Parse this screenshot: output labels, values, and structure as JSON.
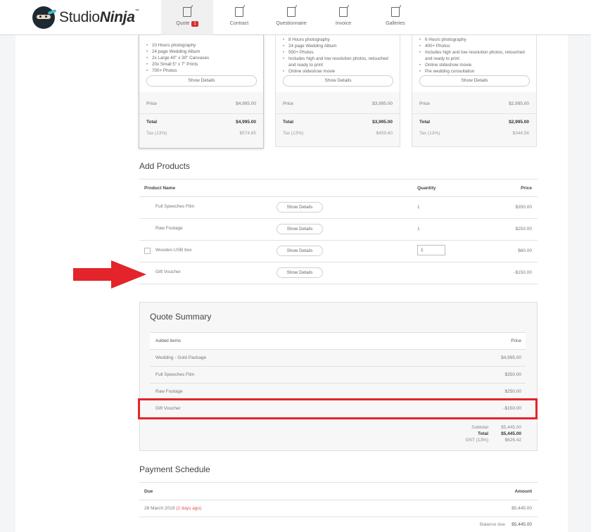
{
  "brand": {
    "name_light": "Studio",
    "name_bold": "Ninja",
    "tm": "™"
  },
  "nav": [
    {
      "label": "Quote",
      "badge": "1"
    },
    {
      "label": "Contract"
    },
    {
      "label": "Questionnaire"
    },
    {
      "label": "Invoice"
    },
    {
      "label": "Galleries"
    }
  ],
  "packages": [
    {
      "features": [
        "10 Hours photography",
        "24 page Wedding Album",
        "2x Large 40\" x 30\" Canvases",
        "20x Small 5\" x 7\" Prints",
        "700+ Photos"
      ],
      "show_details": "Show Details",
      "price_label": "Price",
      "price": "$4,995.00",
      "total_label": "Total",
      "total": "$4,995.00",
      "tax_label": "Tax (13%)",
      "tax": "$574.65"
    },
    {
      "features": [
        "8 Hours photography",
        "24 page Wedding Album",
        "550+ Photos",
        "Includes high and low resolution photos, retouched and ready to print",
        "Online slideshow movie"
      ],
      "show_details": "Show Details",
      "price_label": "Price",
      "price": "$3,995.00",
      "total_label": "Total",
      "total": "$3,995.00",
      "tax_label": "Tax (13%)",
      "tax": "$459.60"
    },
    {
      "features": [
        "6 Hours photography",
        "400+ Photos",
        "Includes high and low resolution photos, retouched and ready to print",
        "Online slideshow movie",
        "Pre wedding consultation"
      ],
      "show_details": "Show Details",
      "price_label": "Price",
      "price": "$2,995.00",
      "total_label": "Total",
      "total": "$2,995.00",
      "tax_label": "Tax (13%)",
      "tax": "$344.56"
    }
  ],
  "add_products": {
    "title": "Add Products",
    "headers": {
      "name": "Product Name",
      "quantity": "Quantity",
      "price": "Price"
    },
    "rows": [
      {
        "name": "Full Speeches Film",
        "button": "Show Details",
        "quantity": "1",
        "price": "$350.00"
      },
      {
        "name": "Raw Footage",
        "button": "Show Details",
        "quantity": "1",
        "price": "$250.00"
      },
      {
        "name": "Wooden USB box",
        "button": "Show Details",
        "quantity": "1",
        "price": "$60.00"
      },
      {
        "name": "Gift Voucher",
        "button": "Show Details",
        "quantity": "",
        "price": "-$150.00"
      }
    ]
  },
  "quote_summary": {
    "title": "Quote Summary",
    "headers": {
      "item": "Added items",
      "price": "Price"
    },
    "rows": [
      {
        "item": "Wedding - Gold Package",
        "price": "$4,995.00"
      },
      {
        "item": "Full Speeches Film",
        "price": "$350.00"
      },
      {
        "item": "Raw Footage",
        "price": "$250.00"
      },
      {
        "item": "Gift Voucher",
        "price": "-$150.00"
      }
    ],
    "subtotal_label": "Subtotal",
    "subtotal": "$5,445.00",
    "total_label": "Total",
    "total": "$5,445.00",
    "gst_label": "GST (13%)",
    "gst": "$626.42"
  },
  "payment_schedule": {
    "title": "Payment Schedule",
    "headers": {
      "due": "Due",
      "amount": "Amount"
    },
    "rows": [
      {
        "date": "28 March 2019",
        "relative": "(2 days ago)",
        "amount": "$5,445.00"
      }
    ],
    "balance_label": "Balance due",
    "balance": "$5,445.00"
  },
  "colors": {
    "accent_red": "#e3242b",
    "badge_red": "#d32f2f",
    "brand_dark": "#1d2a33"
  }
}
